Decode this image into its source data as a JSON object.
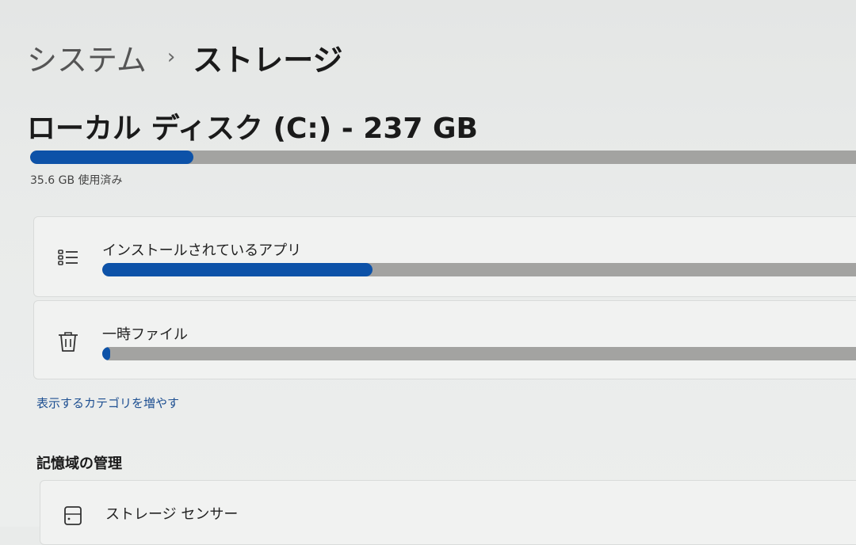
{
  "breadcrumb": {
    "parent": "システム",
    "separator": "›",
    "current": "ストレージ"
  },
  "disk": {
    "title": "ローカル ディスク (C:) - 237 GB",
    "used_text": "35.6 GB 使用済み",
    "used_fraction": 0.198
  },
  "categories": [
    {
      "label": "インストールされているアプリ",
      "icon": "list-icon",
      "fraction": 0.348
    },
    {
      "label": "一時ファイル",
      "icon": "trash-icon",
      "fraction": 0.008
    }
  ],
  "more_link": "表示するカテゴリを増やす",
  "storage_management": {
    "heading": "記憶域の管理",
    "storage_sense": {
      "label": "ストレージ センサー",
      "icon": "drive-icon"
    }
  },
  "colors": {
    "accent": "#0d52a8",
    "bar_track": "#a3a3a1",
    "link": "#1d4f91"
  }
}
